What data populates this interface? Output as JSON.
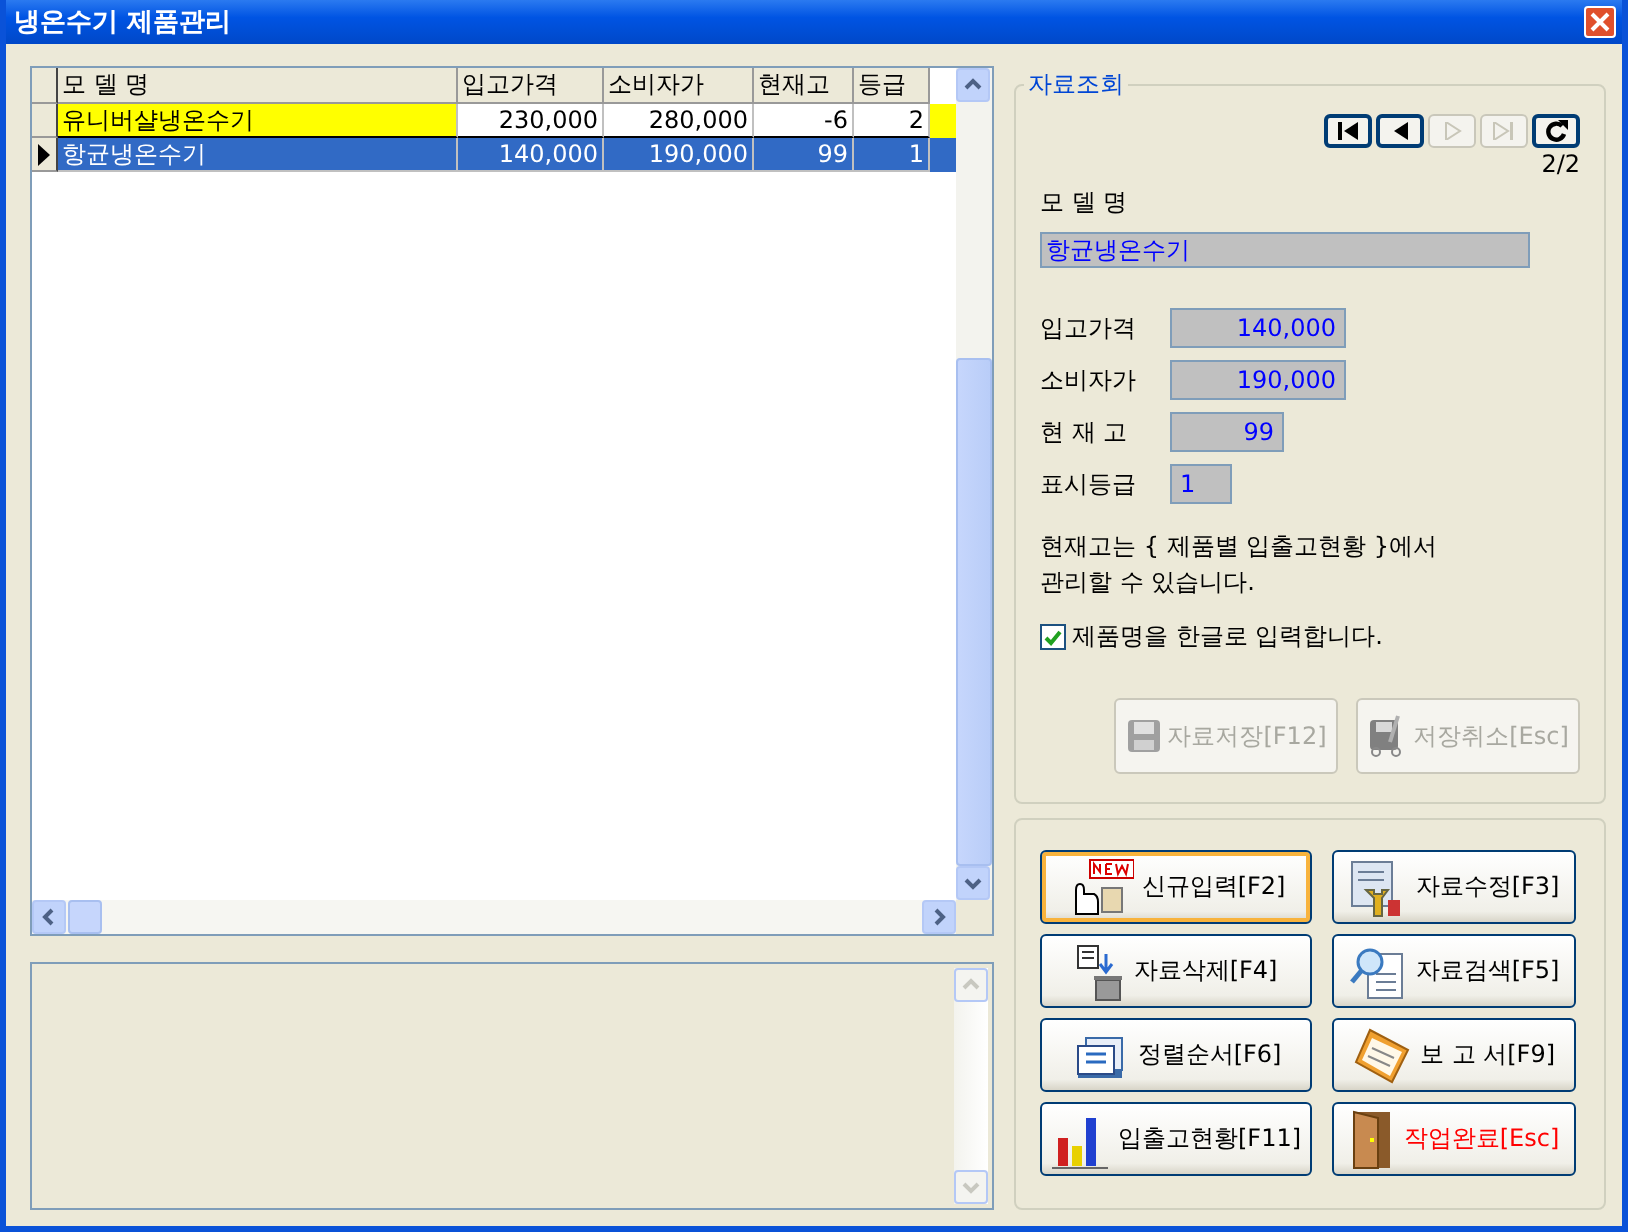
{
  "window": {
    "title": "냉온수기 제품관리"
  },
  "table": {
    "columns": [
      "모 델 명",
      "입고가격",
      "소비자가",
      "현재고",
      "등급"
    ],
    "rows": [
      {
        "cells": [
          "유니버샬냉온수기",
          "230,000",
          "280,000",
          "-6",
          "2"
        ],
        "selected": false,
        "highlighted": true
      },
      {
        "cells": [
          "항균냉온수기",
          "140,000",
          "190,000",
          "99",
          "1"
        ],
        "selected": true,
        "highlighted": false
      }
    ]
  },
  "lookup": {
    "title": "자료조회",
    "nav_buttons": [
      {
        "kind": "first",
        "disabled": false
      },
      {
        "kind": "prev",
        "disabled": false
      },
      {
        "kind": "next",
        "disabled": true
      },
      {
        "kind": "last",
        "disabled": true
      },
      {
        "kind": "refresh",
        "disabled": false
      }
    ],
    "record_counter": "2/2",
    "model_label": "모 델 명",
    "model_value": "항균냉온수기",
    "fields": [
      {
        "label": "입고가격",
        "value": "140,000"
      },
      {
        "label": "소비자가",
        "value": "190,000"
      },
      {
        "label": "현 재 고",
        "value": "99"
      },
      {
        "label": "표시등급",
        "value": "1"
      }
    ],
    "note": "현재고는 { 제품별 입출고현황 }에서\n관리할 수 있습니다.",
    "korean_input": {
      "label": "제품명을 한글로 입력합니다.",
      "checked": true
    },
    "buttons": [
      {
        "kind": "save",
        "label": "자료저장[F12]",
        "disabled": true
      },
      {
        "kind": "cancel",
        "label": "저장취소[Esc]",
        "disabled": true
      }
    ]
  },
  "actions": [
    {
      "kind": "new",
      "label": "신규입력[F2]",
      "focused": true,
      "danger": false
    },
    {
      "kind": "edit",
      "label": "자료수정[F3]",
      "focused": false,
      "danger": false
    },
    {
      "kind": "delete",
      "label": "자료삭제[F4]",
      "focused": false,
      "danger": false
    },
    {
      "kind": "search",
      "label": "자료검색[F5]",
      "focused": false,
      "danger": false
    },
    {
      "kind": "sort",
      "label": "정렬순서[F6]",
      "focused": false,
      "danger": false
    },
    {
      "kind": "report",
      "label": "보 고 서[F9]",
      "focused": false,
      "danger": false
    },
    {
      "kind": "chart",
      "label": "입출고현황[F11]",
      "focused": false,
      "danger": false
    },
    {
      "kind": "exit",
      "label": "작업완료[Esc]",
      "focused": false,
      "danger": true
    }
  ]
}
